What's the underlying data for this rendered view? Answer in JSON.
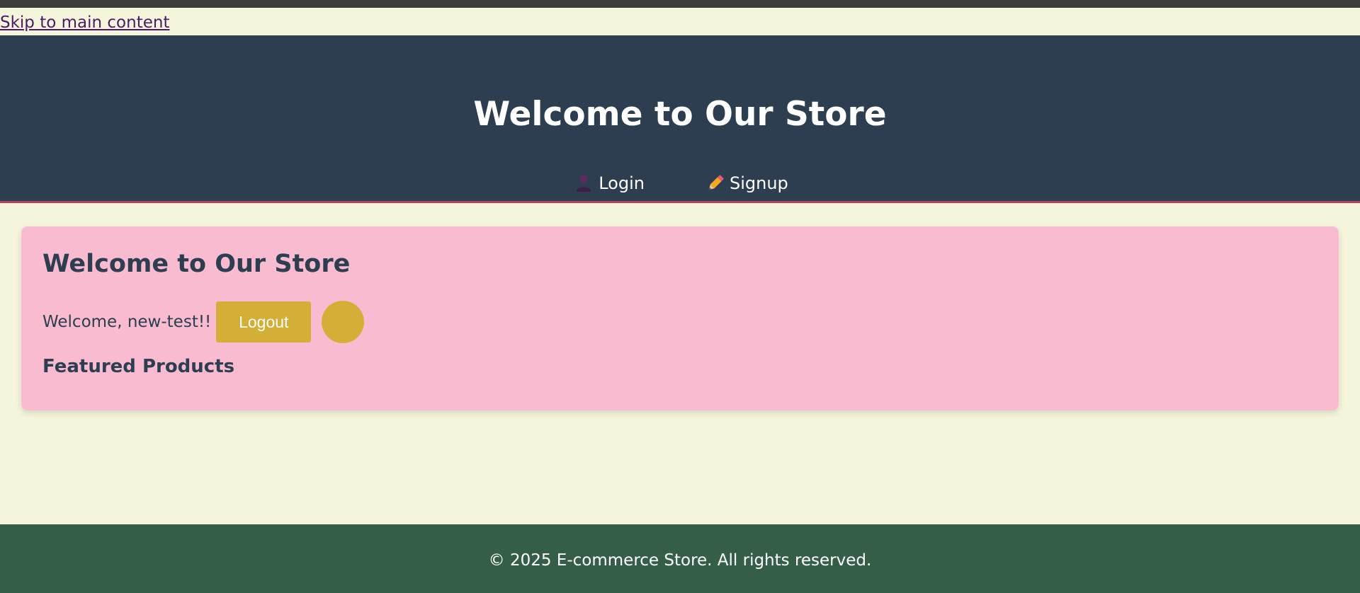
{
  "skip_link": "Skip to main content",
  "header": {
    "title": "Welcome to Our Store",
    "nav": [
      {
        "label": "Login",
        "icon": "user-icon"
      },
      {
        "label": "Signup",
        "icon": "pencil-icon"
      }
    ]
  },
  "main": {
    "title": "Welcome to Our Store",
    "welcome_text": "Welcome, new-test!!",
    "logout_label": "Logout",
    "featured_heading": "Featured Products"
  },
  "footer": {
    "text": "© 2025 E-commerce Store. All rights reserved."
  },
  "colors": {
    "page_background": "#f5f5dc",
    "header_background": "#2d3e50",
    "header_border": "#b5435a",
    "card_background": "#f8bbd0",
    "accent_gold": "#d4af37",
    "footer_background": "#355e47",
    "link_purple": "#4b1a6b"
  }
}
